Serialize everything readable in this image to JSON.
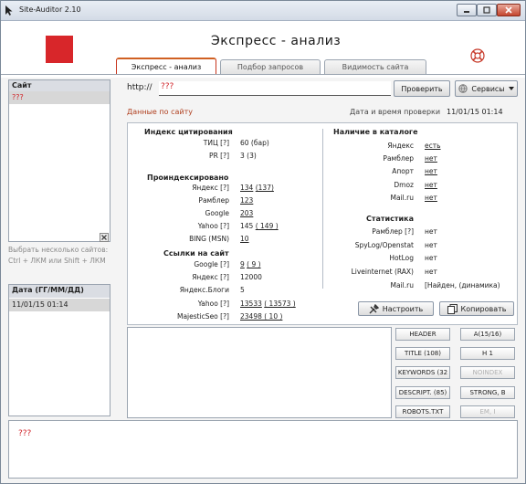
{
  "window": {
    "title": "Site-Auditor 2.10"
  },
  "header": {
    "heading": "Экспресс - анализ"
  },
  "tabs": [
    {
      "label": "Экспресс - анализ"
    },
    {
      "label": "Подбор запросов"
    },
    {
      "label": "Видимость сайта"
    }
  ],
  "sidebar": {
    "sites_header": "Сайт",
    "sites": [
      "???"
    ],
    "hint_line1": "Выбрать несколько сайтов:",
    "hint_line2": "Ctrl + ЛКМ или Shift + ЛКМ",
    "dates_header": "Дата (ГГ/ММ/ДД)",
    "dates": [
      "11/01/15 01:14"
    ]
  },
  "url_bar": {
    "label": "http://",
    "value": "???",
    "check_button": "Проверить",
    "services_button": "Сервисы"
  },
  "data_section": {
    "title": "Данные по сайту",
    "check_datetime_label": "Дата и время проверки",
    "check_datetime_value": "11/01/15 01:14"
  },
  "citation": {
    "title": "Индекс цитирования",
    "rows": [
      {
        "label": "ТИЦ [?]",
        "value": "60 (бар)"
      },
      {
        "label": "PR [?]",
        "value": "3 (3)"
      }
    ]
  },
  "indexed": {
    "title": "Проиндексировано",
    "rows": [
      {
        "label": "Яндекс [?]",
        "value": "134",
        "extra": "(137)"
      },
      {
        "label": "Рамблер",
        "value": "123",
        "extra": ""
      },
      {
        "label": "Google",
        "value": "203",
        "extra": ""
      },
      {
        "label": "Yahoo [?]",
        "value": "145",
        "extra": "( 149 )"
      },
      {
        "label": "BING (MSN)",
        "value": "10",
        "extra": ""
      }
    ]
  },
  "links": {
    "title": "Ссылки на сайт",
    "rows": [
      {
        "label": "Google [?]",
        "value": "9",
        "extra": "( 9 )"
      },
      {
        "label": "Яндекс [?]",
        "value": "12000",
        "extra": ""
      },
      {
        "label": "Яндекс.Блоги",
        "value": "5",
        "extra": ""
      },
      {
        "label": "Yahoo [?]",
        "value": "13533",
        "extra": "( 13573 )"
      },
      {
        "label": "MajesticSeo [?]",
        "value": "23498 ( 10 )",
        "extra": ""
      }
    ]
  },
  "catalogs": {
    "title": "Наличие в каталоге",
    "rows": [
      {
        "label": "Яндекс",
        "value": "есть"
      },
      {
        "label": "Рамблер",
        "value": "нет"
      },
      {
        "label": "Апорт",
        "value": "нет"
      },
      {
        "label": "Dmoz",
        "value": "нет"
      },
      {
        "label": "Mail.ru",
        "value": "нет"
      }
    ]
  },
  "stats": {
    "title": "Статистика",
    "rows": [
      {
        "label": "Рамблер [?]",
        "value": "нет"
      },
      {
        "label": "SpyLog/Openstat",
        "value": "нет"
      },
      {
        "label": "HotLog",
        "value": "нет"
      },
      {
        "label": "Liveinternet (RAX)",
        "value": "нет"
      },
      {
        "label": "Mail.ru",
        "value": "[Найден, (динамика)"
      }
    ]
  },
  "actions": {
    "settings_button": "Настроить",
    "copy_button": "Копировать"
  },
  "seo_buttons": [
    {
      "label": "HEADER",
      "disabled": false
    },
    {
      "label": "A(15/16)",
      "disabled": false
    },
    {
      "label": "TITLE (108)",
      "disabled": false
    },
    {
      "label": "H 1",
      "disabled": false
    },
    {
      "label": "KEYWORDS (32",
      "disabled": false
    },
    {
      "label": "NOINDEX",
      "disabled": true
    },
    {
      "label": "DESCRIPT. (85)",
      "disabled": false
    },
    {
      "label": "STRONG, B",
      "disabled": false
    },
    {
      "label": "ROBOTS.TXT",
      "disabled": false
    },
    {
      "label": "EM, I",
      "disabled": true
    }
  ],
  "status": {
    "text": "???"
  }
}
